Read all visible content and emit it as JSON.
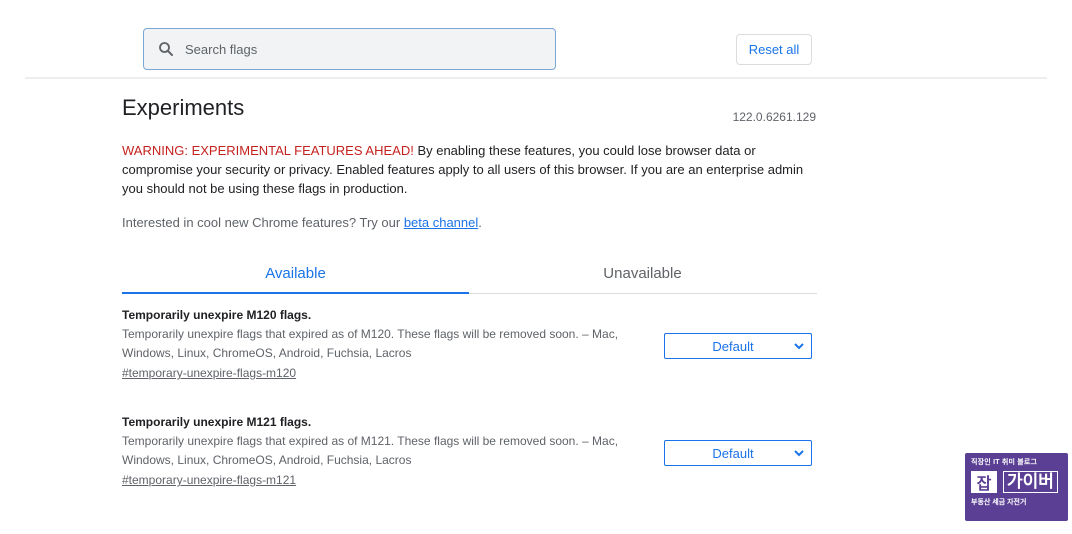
{
  "header": {
    "search_placeholder": "Search flags",
    "reset_label": "Reset all"
  },
  "intro": {
    "title": "Experiments",
    "version": "122.0.6261.129",
    "warning_label": "WARNING: EXPERIMENTAL FEATURES AHEAD!",
    "warning_text": " By enabling these features, you could lose browser data or compromise your security or privacy. Enabled features apply to all users of this browser. If you are an enterprise admin you should not be using these flags in production.",
    "interested_text": "Interested in cool new Chrome features? Try our ",
    "beta_link": "beta channel",
    "interested_end": "."
  },
  "tabs": {
    "available": "Available",
    "unavailable": "Unavailable"
  },
  "experiments": [
    {
      "name": "Temporarily unexpire M120 flags.",
      "description": "Temporarily unexpire flags that expired as of M120. These flags will be removed soon. – Mac, Windows, Linux, ChromeOS, Android, Fuchsia, Lacros",
      "link": "#temporary-unexpire-flags-m120",
      "selected": "Default"
    },
    {
      "name": "Temporarily unexpire M121 flags.",
      "description": "Temporarily unexpire flags that expired as of M121. These flags will be removed soon. – Mac, Windows, Linux, ChromeOS, Android, Fuchsia, Lacros",
      "link": "#temporary-unexpire-flags-m121",
      "selected": "Default"
    }
  ],
  "watermark": {
    "top": "직장인 IT 취미 블로그",
    "char": "잡",
    "word": "가이버",
    "bottom": "부동산 세금 자전거"
  },
  "colors": {
    "accent": "#1a73e8",
    "warning": "#c5221f",
    "watermark_bg": "#5b3f94"
  },
  "icons": {
    "search": "search-icon",
    "dropdown": "chevron-down-icon"
  }
}
